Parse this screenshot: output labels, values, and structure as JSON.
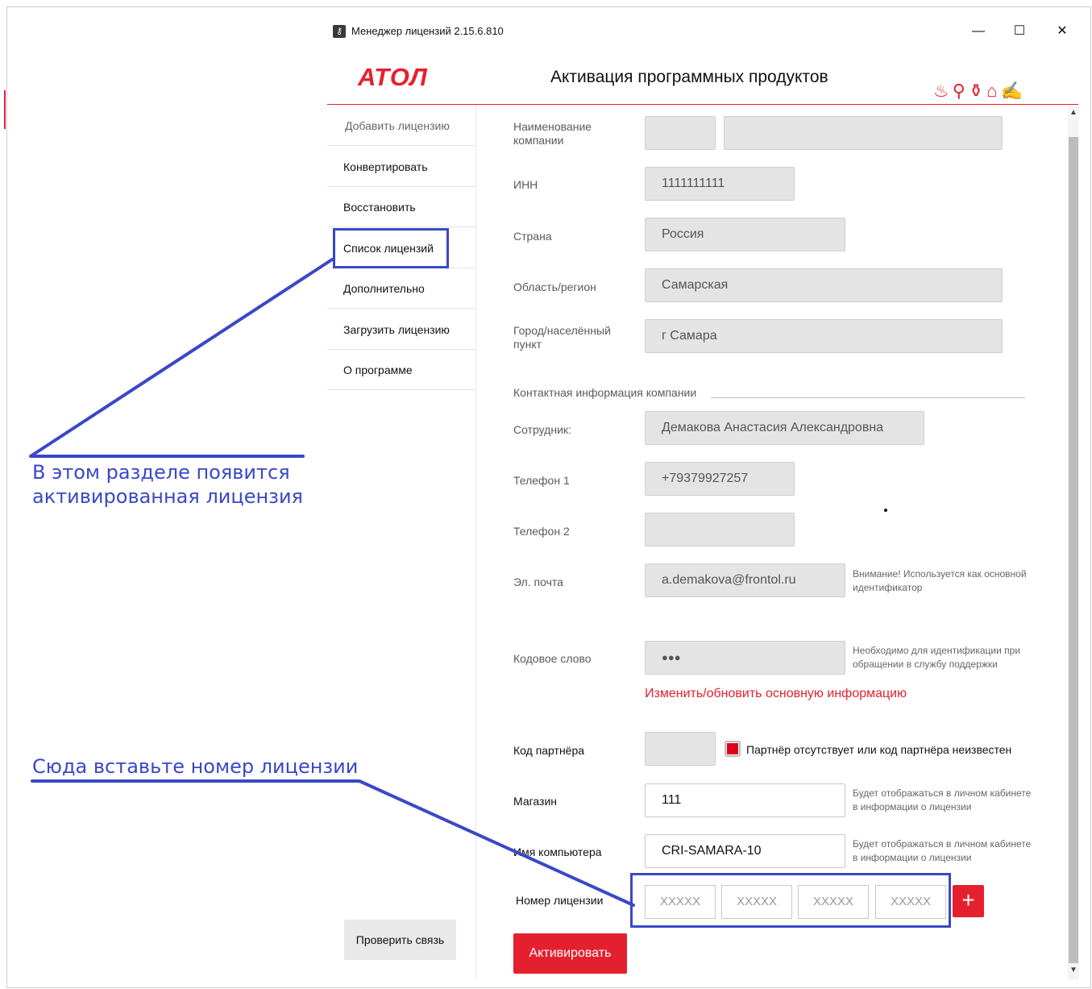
{
  "window": {
    "title": "Менеджер лицензий 2.15.6.810",
    "minimize": "—",
    "maximize": "☐",
    "close": "✕"
  },
  "header": {
    "logo": "АТОЛ",
    "title": "Активация программных продуктов",
    "decoration_icons": "♨⚲⚱⌂✍"
  },
  "sidebar": {
    "items": [
      {
        "label": "Добавить лицензию"
      },
      {
        "label": "Конвертировать"
      },
      {
        "label": "Восстановить"
      },
      {
        "label": "Список лицензий"
      },
      {
        "label": "Дополнительно"
      },
      {
        "label": "Загрузить лицензию"
      },
      {
        "label": "О программе"
      }
    ],
    "check_connection": "Проверить связь"
  },
  "form": {
    "company_name": {
      "label": "Наименование компании",
      "value1": "",
      "value2": ""
    },
    "inn": {
      "label": "ИНН",
      "value": "1111111111"
    },
    "country": {
      "label": "Страна",
      "value": "Россия"
    },
    "region": {
      "label": "Область/регион",
      "value": "Самарская"
    },
    "city": {
      "label": "Город/населённый пункт",
      "value": "г Самара"
    },
    "contact_section": "Контактная информация компании",
    "employee": {
      "label": "Сотрудник:",
      "value": "Демакова Анастасия Александровна"
    },
    "phone1": {
      "label": "Телефон 1",
      "value": "+79379927257"
    },
    "phone2": {
      "label": "Телефон 2",
      "value": ""
    },
    "email": {
      "label": "Эл. почта",
      "value": "a.demakova@frontol.ru",
      "hint": "Внимание! Используется как основной идентификатор"
    },
    "codeword": {
      "label": "Кодовое слово",
      "value": "●●●",
      "hint": "Необходимо для идентификации при обращении в службу поддержки"
    },
    "update_link": "Изменить/обновить основную информацию",
    "partner_code": {
      "label": "Код партнёра",
      "value": "",
      "checkbox_label": "Партнёр отсутствует или код партнёра неизвестен"
    },
    "store": {
      "label": "Магазин",
      "value": "111",
      "hint": "Будет отображаться в личном кабинете в информации о лицензии"
    },
    "computer": {
      "label": "Имя компьютера",
      "value": "CRI-SAMARA-10",
      "hint": "Будет отображаться в личном кабинете в информации о лицензии"
    },
    "license_number": {
      "label": "Номер лицензии",
      "placeholders": [
        "XXXXX",
        "XXXXX",
        "XXXXX",
        "XXXXX"
      ],
      "add": "+"
    },
    "activate": "Активировать"
  },
  "annotations": {
    "list_note": "В этом разделе появится активированная лицензия",
    "paste_note": "Сюда вставьте номер лицензии",
    "color": "#3a48c6"
  },
  "colors": {
    "accent": "#e5202e",
    "annotation": "#3a48c6"
  }
}
